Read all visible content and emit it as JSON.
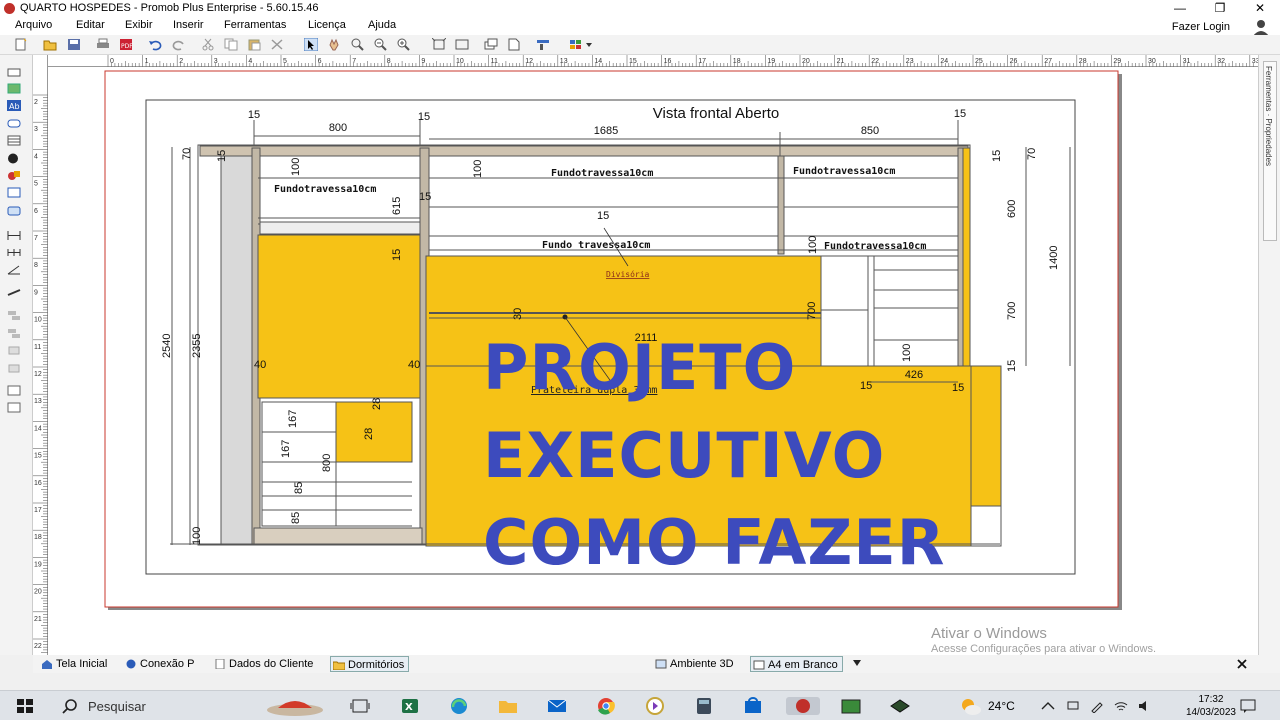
{
  "window": {
    "title": "QUARTO HOSPEDES - Promob Plus Enterprise - 5.60.15.46",
    "login": "Fazer Login",
    "minimize": "—",
    "maximize": "❐",
    "close": "✕"
  },
  "menu": [
    "Arquivo",
    "Editar",
    "Exibir",
    "Inserir",
    "Ferramentas",
    "Licença",
    "Ajuda"
  ],
  "ruler_top": [
    "0",
    "1",
    "2",
    "3",
    "4",
    "5",
    "6",
    "7",
    "8",
    "9",
    "10",
    "11",
    "12",
    "13",
    "14",
    "15",
    "16",
    "17",
    "18",
    "19",
    "20",
    "21",
    "22",
    "23",
    "24",
    "25",
    "26",
    "27",
    "28",
    "29",
    "30",
    "31",
    "32",
    "33"
  ],
  "ruler_left": [
    "2",
    "3",
    "4",
    "5",
    "6",
    "7",
    "8",
    "9",
    "10",
    "11",
    "12",
    "13",
    "14",
    "15",
    "16",
    "17",
    "18",
    "19",
    "20",
    "21",
    "22"
  ],
  "right_panel": "Ferramentas · Propriedades",
  "drawing": {
    "view_title": "Vista frontal Aberto",
    "dims": {
      "d15a": "15",
      "d800": "800",
      "d15b": "15",
      "d1685": "1685",
      "d850": "850",
      "d15c": "15",
      "d70l": "70",
      "d15l": "15",
      "d2540": "2540",
      "d2355": "2355",
      "d100b": "100",
      "d100a": "100",
      "d615": "615",
      "d15m": "15",
      "d15n": "15",
      "d15o": "15",
      "d100c": "100",
      "d100d": "100",
      "d30": "30",
      "d700m": "700",
      "d2111": "2111",
      "d100e": "100",
      "d40a": "40",
      "d40b": "40",
      "d28a": "28",
      "d28b": "28",
      "d167a": "167",
      "d167b": "167",
      "d800b": "800",
      "d85a": "85",
      "d85b": "85",
      "d426": "426",
      "d15p": "15",
      "d15q": "15",
      "d15r": "15",
      "d70r": "70",
      "d600": "600",
      "d1400": "1400",
      "d700r": "700",
      "d15s": "15"
    },
    "labels": {
      "fundo1": "Fundotravessa10cm",
      "fundo2": "Fundotravessa10cm",
      "fundo3": "Fundotravessa10cm",
      "fundo4": "Fundo travessa10cm",
      "fundo5": "Fundotravessa10cm",
      "divisoria": "Divisória",
      "prateleira": "Prateleira dupla 30mm"
    }
  },
  "headline": [
    "PROJETO",
    "EXECUTIVO",
    "COMO FAZER"
  ],
  "bottom_tabs": [
    "Tela Inicial",
    "Conexão P",
    "Dados do Cliente",
    "Dormitórios",
    "Ambiente 3D",
    "A4 em Branco"
  ],
  "watermark": {
    "line1": "Ativar o Windows",
    "line2": "Acesse Configurações para ativar o Windows."
  },
  "taskbar": {
    "search": "Pesquisar",
    "temperature": "24°C",
    "time": "17:32",
    "date": "14/03/2023"
  },
  "colors": {
    "panel_yellow": "#f6c216",
    "headline_blue": "#3d4bbd",
    "line": "#444444"
  }
}
